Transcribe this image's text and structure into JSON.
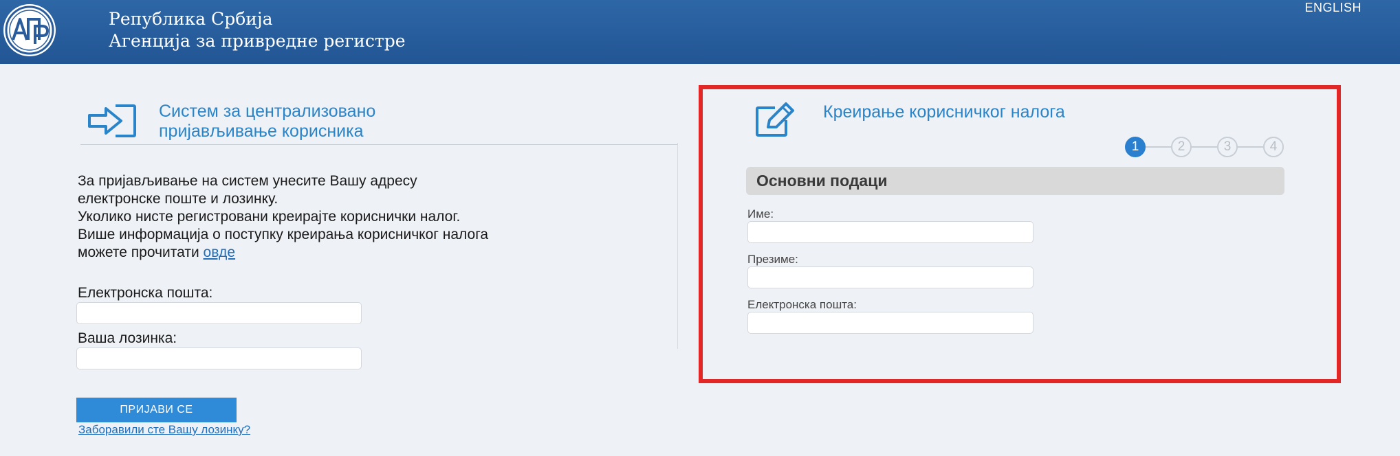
{
  "header": {
    "org_line1": "Република Србија",
    "org_line2": "Агенција за привредне регистре",
    "language_link": "ENGLISH"
  },
  "login": {
    "title_line1": "Систем за централизовано",
    "title_line2": "пријављивање корисника",
    "intro_lines": [
      "За пријављивање на систем унесите Вашу адресу",
      "електронске поште и лозинку.",
      "Уколико нисте регистровани креирајте кориснички налог.",
      "Више информација о поступку креирања корисничког налога"
    ],
    "intro_last_prefix": "можете прочитати",
    "intro_link": "овде",
    "email_label": "Електронска пошта:",
    "email_value": "",
    "password_label": "Ваша лозинка:",
    "password_value": "",
    "submit_label": "ПРИЈАВИ СЕ",
    "forgot_link": "Заборавили сте Вашу лозинку?"
  },
  "register": {
    "title": "Креирање корисничког налога",
    "steps": [
      "1",
      "2",
      "3",
      "4"
    ],
    "active_step": 1,
    "section_title": "Основни подаци",
    "first_name_label": "Име:",
    "first_name_value": "",
    "last_name_label": "Презиме:",
    "last_name_value": "",
    "email_label": "Електронска пошта:",
    "email_value": ""
  },
  "logo": {
    "letters": "АПР"
  },
  "colors": {
    "header": "#2a5c9b",
    "accent": "#2a84c9",
    "button": "#2f8ad8",
    "highlight": "#e32626"
  },
  "icons": {
    "login": "login-arrow-icon",
    "register": "edit-pencil-icon"
  }
}
